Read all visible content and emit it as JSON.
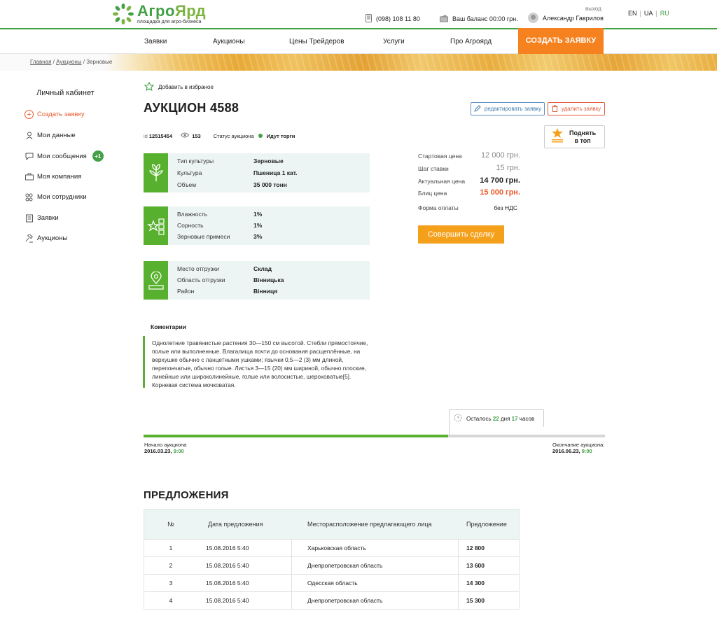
{
  "header": {
    "logo_title_a": "Агро",
    "logo_title_b": "Ярд",
    "logo_subtitle": "площадка для агро-бизнеса",
    "phone": "(098) 108 11 80",
    "balance": "Ваш баланс 00:00 грн.",
    "user_name": "Александр Гаврилов",
    "logout": "выход",
    "langs": [
      "EN",
      "UA",
      "RU"
    ],
    "active_lang": "RU"
  },
  "nav": {
    "items": [
      "Заявки",
      "Аукционы",
      "Цены Трейдеров",
      "Услуги",
      "Про Агроярд"
    ],
    "cta": "СОЗДАТЬ ЗАЯВКУ"
  },
  "breadcrumb": {
    "home": "Главная",
    "auctions": "Аукционы",
    "current": "Зерновые",
    "sep": " / "
  },
  "sidebar": {
    "title": "Личный кабинет",
    "items": [
      {
        "label": "Создать заявку"
      },
      {
        "label": "Мои данные"
      },
      {
        "label": "Мои сообщения",
        "badge": "+1"
      },
      {
        "label": "Моя компания"
      },
      {
        "label": "Мои сотрудники"
      },
      {
        "label": "Заявки"
      },
      {
        "label": "Аукционы"
      }
    ]
  },
  "main": {
    "favorite": "Добавить в избраное",
    "title": "АУКЦИОН 4588",
    "edit_btn": "редактировать заявку",
    "delete_btn": "удалить заявку",
    "raise_btn_1": "Поднять",
    "raise_btn_2": "в топ",
    "id_label": "id",
    "id_value": "12515454",
    "views": "153",
    "status_label": "Статус аукциона",
    "status_value": "Идут торги"
  },
  "cards": [
    {
      "rows": [
        {
          "label": "Тип культуры",
          "value": "Зерновые"
        },
        {
          "label": "Культура",
          "value": "Пшеница 1 кат."
        },
        {
          "label": "Объем",
          "value": "35 000 тонн"
        }
      ]
    },
    {
      "rows": [
        {
          "label": "Влажность",
          "value": "1%"
        },
        {
          "label": "Сорность",
          "value": "1%"
        },
        {
          "label": "Зерновые примеси",
          "value": "3%"
        }
      ]
    },
    {
      "rows": [
        {
          "label": "Место отгрузки",
          "value": "Склад"
        },
        {
          "label": "Область отгрузки",
          "value": "Вінницька"
        },
        {
          "label": "Район",
          "value": "Вінниця"
        }
      ]
    }
  ],
  "prices": {
    "start_label": "Стартовая цена",
    "start_value": "12 000 грн.",
    "step_label": "Шаг ставки",
    "step_value": "15 грн.",
    "actual_label": "Актуальная цена",
    "actual_value": "14 700 грн.",
    "blitz_label": "Блиц цена",
    "blitz_value": "15 000 грн.",
    "pay_label": "Форма оплаты",
    "pay_value": "без НДС",
    "deal_btn": "Совершить сделку"
  },
  "comments": {
    "title": "Коментарии",
    "text": "Однолетние травянистые растения 30—150 см высотой. Стебли прямостоячие, полые или выполненные. Влагалища почти до основания расщеплённые, на верхушке обычно с ланцетными ушками; язычки 0,5—2 (3) мм длиной, перепончатые, обычно голые. Листья 3—15 (20) мм шириной, обычно плоские, линейные или широколинейные, голые или волосистые, шероховатые[5]. Корневая система мочковатая."
  },
  "timeline": {
    "remaining_prefix": "Осталось",
    "days": "22",
    "days_label": "дня",
    "hours": "17",
    "hours_label": "часов",
    "progress": 0.66,
    "start_label": "Начало аукциона",
    "start_date": "2016.03.23,",
    "start_time": "9:00",
    "end_label": "Окончание аукциона:",
    "end_date": "2016.06.23,",
    "end_time": "9:00"
  },
  "offers": {
    "title": "ПРЕДЛОЖЕНИЯ",
    "headers": [
      "№",
      "Дата предложения",
      "Месторасположение предлагающего лица",
      "Предложение"
    ],
    "rows": [
      [
        "1",
        "15.08.2016 5:40",
        "Харьковская область",
        "12 800"
      ],
      [
        "2",
        "15.08.2016 5:40",
        "Днепропетровская область",
        "13 600"
      ],
      [
        "3",
        "15.08.2016 5:40",
        "Одесская область",
        "14 300"
      ],
      [
        "4",
        "15.08.2016 5:40",
        "Днепропетровская область",
        "15 300"
      ]
    ]
  },
  "colors": {
    "accent_green": "#43a047",
    "orange": "#f5811f",
    "deal_orange": "#f5a01a",
    "red": "#ec5a2a"
  }
}
